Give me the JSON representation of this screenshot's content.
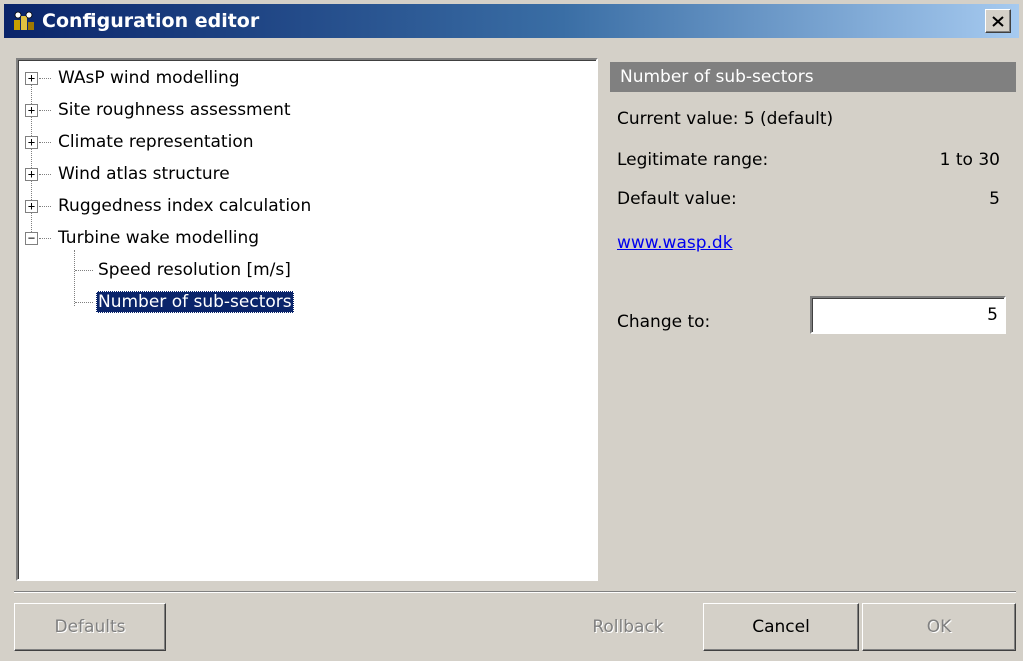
{
  "window": {
    "title": "Configuration editor",
    "close_label": "×"
  },
  "tree": {
    "items": [
      {
        "label": "WAsP wind modelling",
        "expander": "+"
      },
      {
        "label": "Site roughness assessment",
        "expander": "+"
      },
      {
        "label": "Climate representation",
        "expander": "+"
      },
      {
        "label": "Wind atlas structure",
        "expander": "+"
      },
      {
        "label": "Ruggedness index calculation",
        "expander": "+"
      },
      {
        "label": "Turbine wake modelling",
        "expander": "−"
      }
    ],
    "children": [
      {
        "label": "Speed resolution [m/s]"
      },
      {
        "label": "Number of sub-sectors",
        "selected": true
      }
    ]
  },
  "detail": {
    "header": "Number of sub-sectors",
    "current_value": "Current value: 5 (default)",
    "range_label": "Legitimate range:",
    "range_value": "1 to 30",
    "default_label": "Default value:",
    "default_value": "5",
    "link": "www.wasp.dk",
    "change_label": "Change to:",
    "change_value": "5"
  },
  "buttons": {
    "defaults": "Defaults",
    "rollback": "Rollback",
    "cancel": "Cancel",
    "ok": "OK"
  },
  "colors": {
    "title_bar": "#0a246a",
    "selection": "#0a246a",
    "header_bar": "#808080",
    "link": "#0000ee"
  }
}
